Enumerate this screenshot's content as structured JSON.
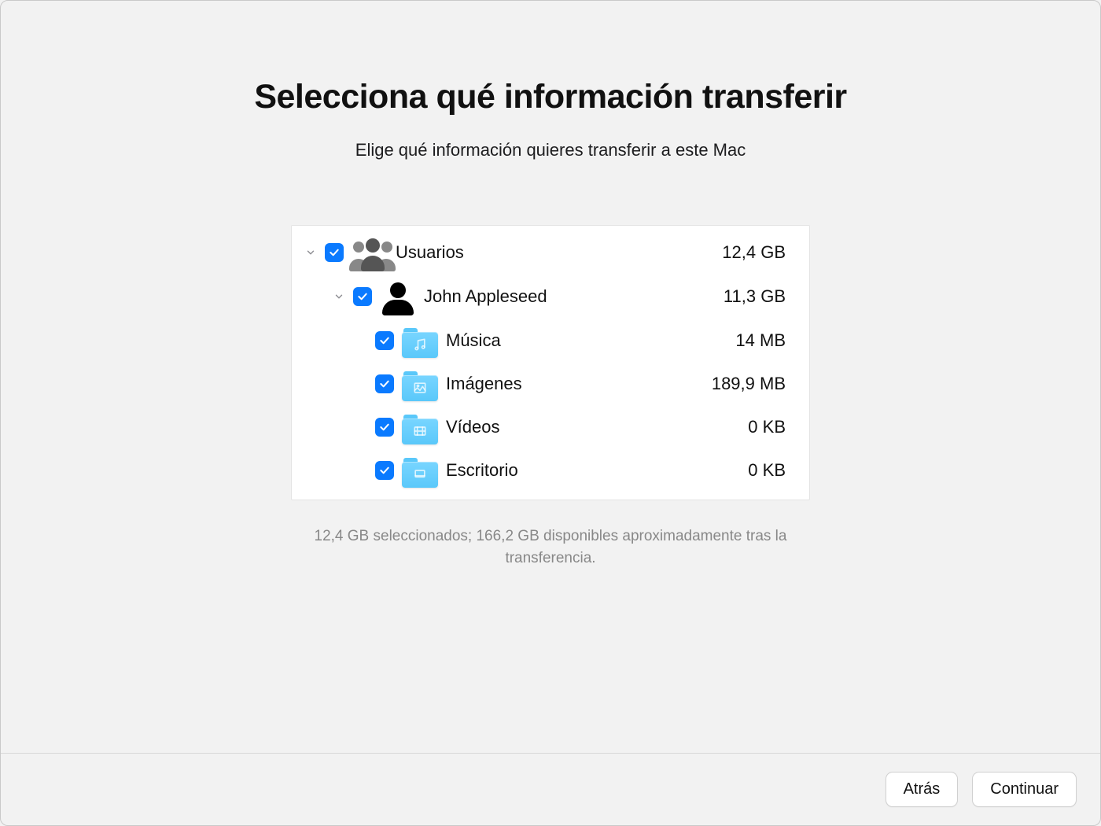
{
  "title": "Selecciona qué información transferir",
  "subtitle": "Elige qué información quieres transferir a este Mac",
  "tree": {
    "users": {
      "label": "Usuarios",
      "size": "12,4 GB"
    },
    "user_john": {
      "label": "John Appleseed",
      "size": "11,3 GB"
    },
    "music": {
      "label": "Música",
      "size": "14 MB"
    },
    "pictures": {
      "label": "Imágenes",
      "size": "189,9 MB"
    },
    "videos": {
      "label": "Vídeos",
      "size": "0 KB"
    },
    "desktop": {
      "label": "Escritorio",
      "size": "0 KB"
    }
  },
  "summary": "12,4 GB seleccionados; 166,2 GB disponibles aproximadamente tras la transferencia.",
  "buttons": {
    "back": "Atrás",
    "continue": "Continuar"
  }
}
